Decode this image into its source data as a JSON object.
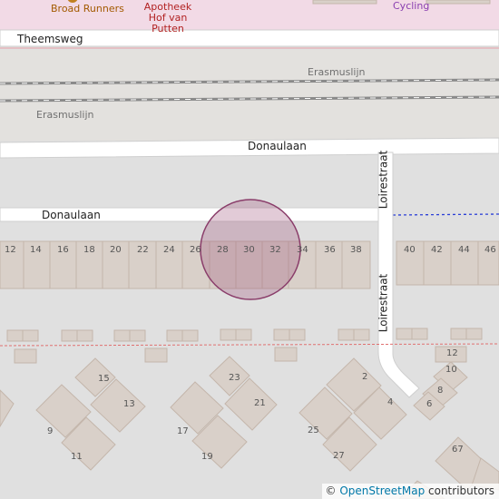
{
  "map": {
    "pois": {
      "broad_runners": "Broad Runners",
      "apotheek": "Apotheek Hof van Putten",
      "cycling": "Cycling"
    },
    "streets": {
      "theemsweg": "Theemsweg",
      "donaulaan_main": "Donaulaan",
      "donaulaan_west": "Donaulaan",
      "loirestraat_north": "Loirestraat",
      "loirestraat_south": "Loirestraat"
    },
    "railways": {
      "erasmuslijn_north": "Erasmuslijn",
      "erasmuslijn_south": "Erasmuslijn"
    },
    "house_numbers_row": [
      "12",
      "14",
      "16",
      "18",
      "20",
      "22",
      "24",
      "26",
      "28",
      "30",
      "32",
      "34",
      "36",
      "38",
      "40",
      "42",
      "44",
      "46"
    ],
    "house_numbers_south": [
      "15",
      "13",
      "9",
      "11",
      "23",
      "21",
      "17",
      "19",
      "2",
      "4",
      "25",
      "27",
      "12",
      "10",
      "8",
      "6",
      "67"
    ],
    "highlight_color": "#a0527a",
    "attribution": {
      "symbol": "©",
      "link_text": "OpenStreetMap",
      "suffix": "contributors"
    }
  }
}
